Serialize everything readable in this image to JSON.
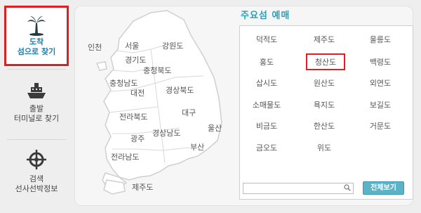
{
  "sidebar": {
    "items": [
      {
        "icon": "palm-tree-icon",
        "label1": "도착",
        "label2": "섬으로 찾기",
        "active": true
      },
      {
        "icon": "ship-icon",
        "label1": "출발",
        "label2": "터미널로 찾기"
      },
      {
        "icon": "ship-wheel-icon",
        "label1": "검색",
        "label2": "선사선박정보"
      }
    ]
  },
  "map": {
    "regions": [
      "인천",
      "서울",
      "경기도",
      "강원도",
      "충청북도",
      "충청남도",
      "대전",
      "경상북도",
      "대구",
      "전라북도",
      "울산",
      "광주",
      "경상남도",
      "부산",
      "전라남도",
      "제주도"
    ]
  },
  "islands_panel": {
    "title": "주요섬 예매",
    "islands": [
      "덕적도",
      "제주도",
      "울릉도",
      "홍도",
      "청산도",
      "백령도",
      "삽시도",
      "원산도",
      "외연도",
      "소매물도",
      "욕지도",
      "보길도",
      "비금도",
      "한산도",
      "거문도",
      "금오도",
      "위도"
    ],
    "selected": "청산도",
    "search_placeholder": "",
    "view_all_label": "전체보기"
  },
  "colors": {
    "accent": "#2da0b8",
    "highlight": "#e02020",
    "button": "#5bb3c8"
  }
}
